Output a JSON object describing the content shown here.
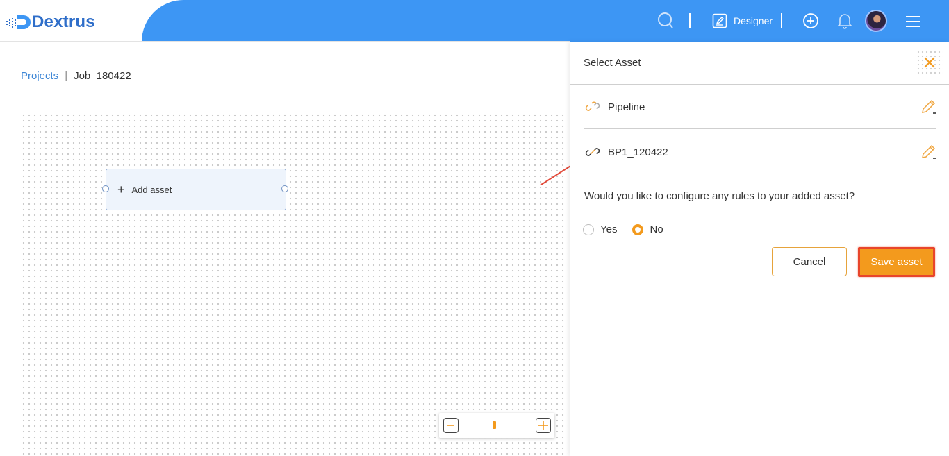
{
  "header": {
    "brand": "Dextrus",
    "mode_label": "Designer",
    "icons": [
      "search-icon",
      "edit-icon",
      "add-circle-icon",
      "bell-icon",
      "avatar",
      "menu-icon"
    ]
  },
  "breadcrumb": {
    "parent": "Projects",
    "separator": "|",
    "current": "Job_180422"
  },
  "canvas": {
    "node_label": "Add asset",
    "zoom_level": 0.45
  },
  "panel": {
    "title": "Select Asset",
    "assets": [
      {
        "name": "Pipeline",
        "icon": "link-icon"
      },
      {
        "name": "BP1_120422",
        "icon": "link-icon"
      }
    ],
    "question": "Would you like to configure any rules to your added asset?",
    "options": [
      {
        "label": "Yes",
        "selected": false
      },
      {
        "label": "No",
        "selected": true
      }
    ],
    "cancel_label": "Cancel",
    "save_label": "Save asset"
  },
  "colors": {
    "header_blue": "#3d96f4",
    "accent_orange": "#f39a1d",
    "highlight_red": "#e8452b",
    "link_blue": "#3d86d6"
  }
}
